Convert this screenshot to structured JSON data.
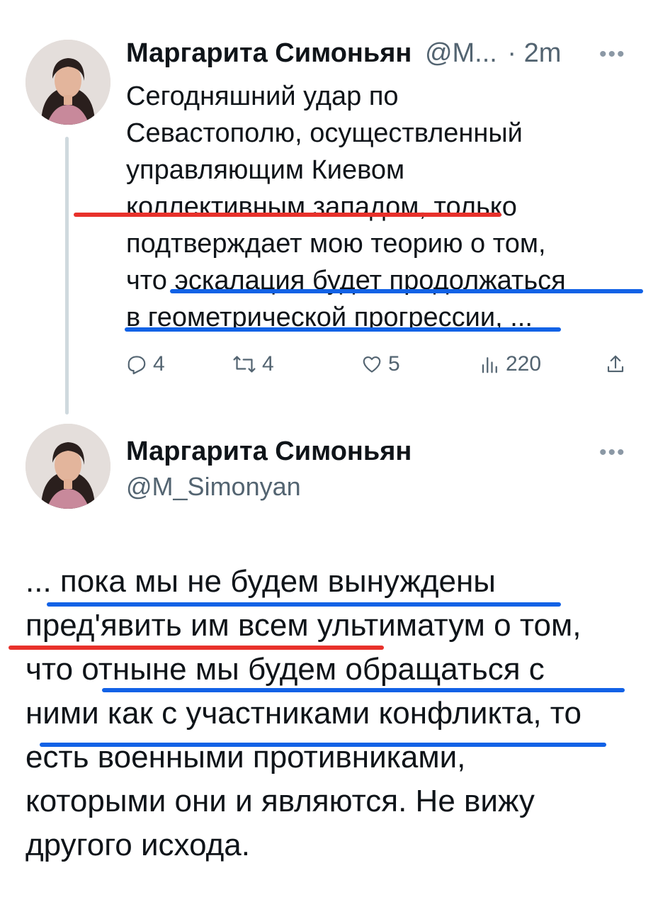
{
  "tweet1": {
    "author_name": "Маргарита Симоньян",
    "author_handle": "@M...",
    "separator": "·",
    "time": "2m",
    "more": "•••",
    "text_lines": [
      "Сегодняшний удар по",
      "Севастополю, осуществленный",
      "управляющим Киевом",
      "коллективным западом, только",
      "подтверждает мою теорию о том,",
      "что эскалация будет продолжаться",
      "в геометрической прогрессии, ..."
    ],
    "actions": {
      "replies": "4",
      "reposts": "4",
      "likes": "5",
      "views": "220"
    }
  },
  "tweet2": {
    "author_name": "Маргарита Симоньян",
    "author_handle": "@M_Simonyan",
    "more": "•••",
    "text_lines": [
      "... пока мы не будем вынуждены",
      "пред'явить им всем ультиматум о том,",
      "что отныне мы будем обращаться с",
      "ними как с участниками конфликта, то",
      "есть военными противниками,",
      "которыми они и являются. Не вижу",
      "другого исхода."
    ]
  },
  "annotations": {
    "red": "#e8312b",
    "blue": "#1262e6"
  },
  "icons": [
    "reply-icon",
    "repost-icon",
    "like-icon",
    "views-icon",
    "share-icon"
  ]
}
